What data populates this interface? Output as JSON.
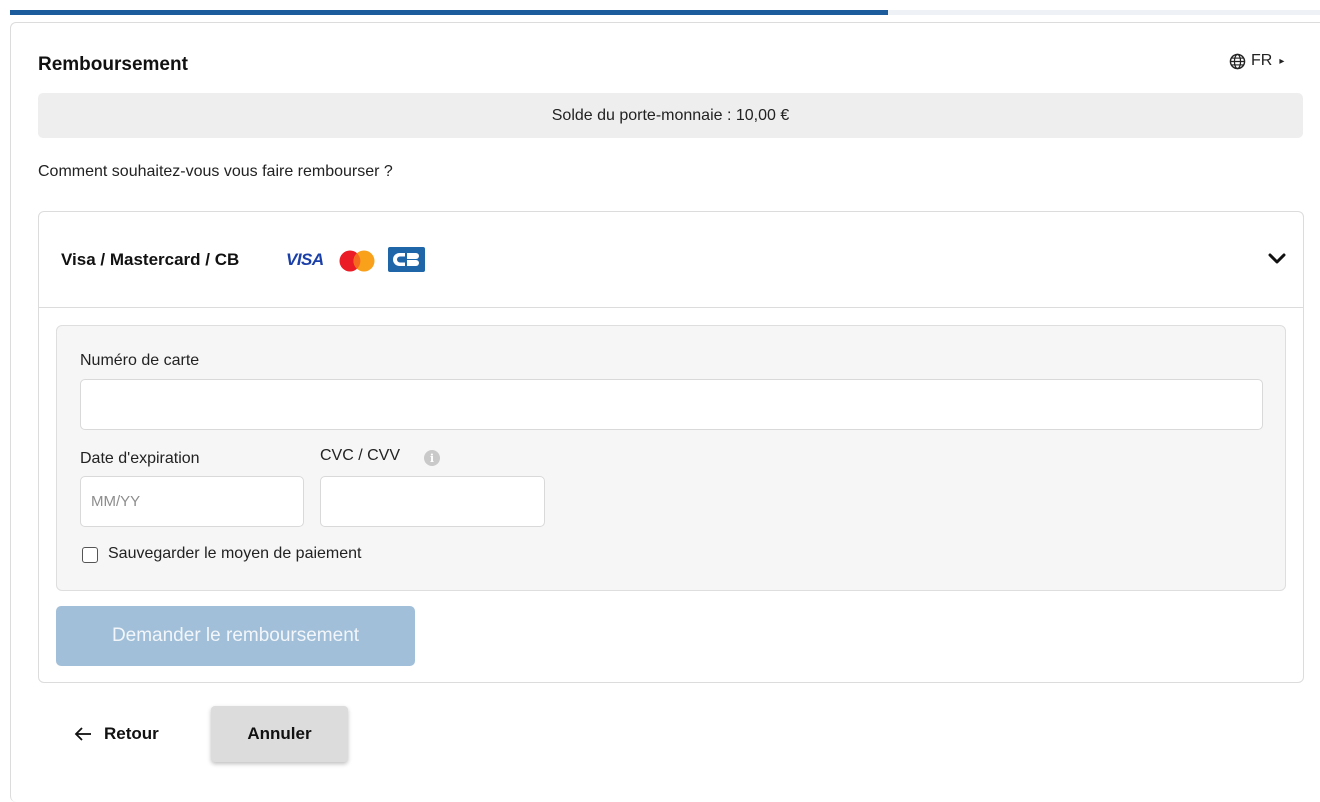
{
  "progress": {
    "fraction": 0.67
  },
  "header": {
    "title": "Remboursement",
    "language": {
      "code": "FR",
      "icon": "globe-icon"
    }
  },
  "wallet": {
    "balance_text": "Solde du porte-monnaie : 10,00 €"
  },
  "question": "Comment souhaitez-vous vous faire rembourser ?",
  "method": {
    "label": "Visa / Mastercard / CB",
    "logos": {
      "visa": "VISA",
      "cb": "CB"
    },
    "expanded": true
  },
  "form": {
    "card_number_label": "Numéro de carte",
    "card_number_value": "",
    "expiry_label": "Date d'expiration",
    "expiry_placeholder": "MM/YY",
    "cvc_label": "CVC / CVV",
    "cvc_value": "",
    "save_label": "Sauvegarder le moyen de paiement",
    "save_checked": false,
    "submit_label": "Demander le remboursement"
  },
  "footer": {
    "back_label": "Retour",
    "cancel_label": "Annuler"
  },
  "colors": {
    "accent": "#1d5c9c",
    "submit_disabled": "#a1bfd8",
    "visa": "#1a3fa8",
    "cb": "#1f66a8"
  }
}
